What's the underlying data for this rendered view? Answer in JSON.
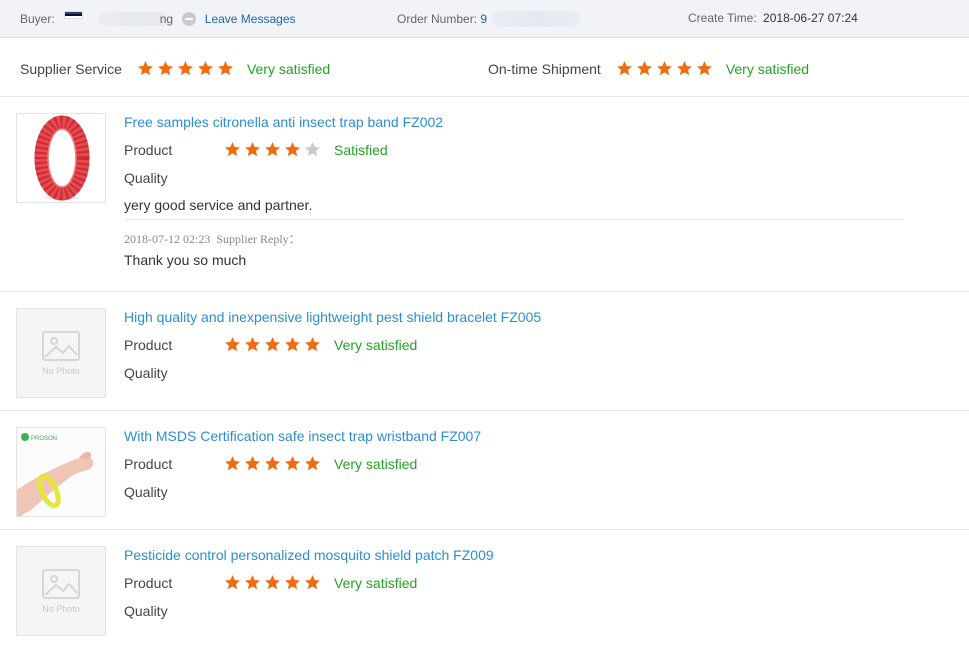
{
  "header": {
    "buyer_label": "Buyer:",
    "buyer_name_fragment": "ng",
    "leave_messages": "Leave Messages",
    "order_label": "Order Number:",
    "order_value_fragment": "9",
    "create_label": "Create Time:",
    "create_time": "2018-06-27 07:24"
  },
  "ratings": {
    "supplier": {
      "label": "Supplier Service",
      "stars": 5,
      "text": "Very satisfied"
    },
    "shipment": {
      "label": "On-time Shipment",
      "stars": 5,
      "text": "Very satisfied"
    }
  },
  "products": [
    {
      "title": "Free samples citronella anti insect trap band FZ002",
      "product_label": "Product",
      "quality_label": "Quality",
      "stars": 4,
      "rating_text": "Satisfied",
      "thumb": "red-bracelet",
      "review": "yery good service and partner.",
      "reply_date": "2018-07-12 02:23",
      "reply_label": "Supplier Reply：",
      "reply_text": "Thank you so much"
    },
    {
      "title": "High quality and inexpensive lightweight pest shield bracelet FZ005",
      "product_label": "Product",
      "quality_label": "Quality",
      "stars": 5,
      "rating_text": "Very satisfied",
      "thumb": "no-photo",
      "no_photo_text": "No Photo"
    },
    {
      "title": "With MSDS Certification safe insect trap wristband FZ007",
      "product_label": "Product",
      "quality_label": "Quality",
      "stars": 5,
      "rating_text": "Very satisfied",
      "thumb": "wristband-photo",
      "thumb_logo_text": "PROSON"
    },
    {
      "title": "Pesticide control personalized mosquito shield patch FZ009",
      "product_label": "Product",
      "quality_label": "Quality",
      "stars": 5,
      "rating_text": "Very satisfied",
      "thumb": "no-photo",
      "no_photo_text": "No Photo"
    }
  ],
  "colors": {
    "star_filled": "#f26c0f",
    "star_empty": "#c9c9c9",
    "satisfied_text": "#23a523",
    "link": "#2a8fcf",
    "header_bg": "#f2f3f7"
  }
}
